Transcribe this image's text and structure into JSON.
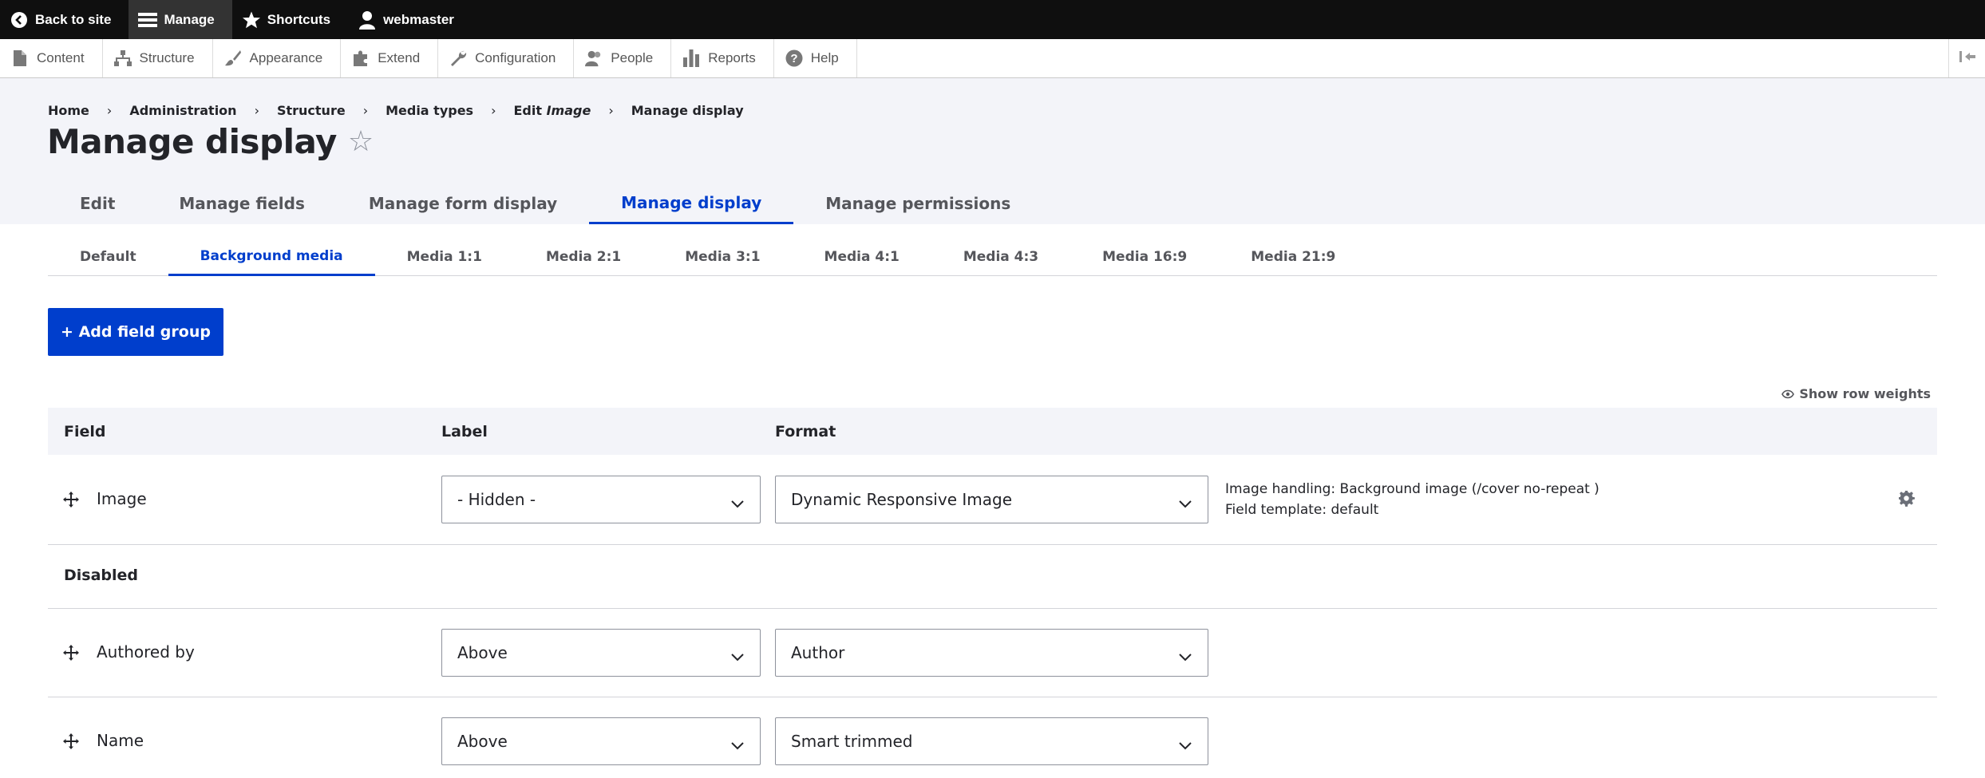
{
  "toolbar": {
    "back_to_site": "Back to site",
    "manage": "Manage",
    "shortcuts": "Shortcuts",
    "user": "webmaster"
  },
  "tray": {
    "items": [
      "Content",
      "Structure",
      "Appearance",
      "Extend",
      "Configuration",
      "People",
      "Reports",
      "Help"
    ]
  },
  "breadcrumb": {
    "items": [
      "Home",
      "Administration",
      "Structure",
      "Media types"
    ],
    "edit_prefix": "Edit ",
    "edit_em": "Image",
    "current": "Manage display",
    "separator": "›"
  },
  "page": {
    "title": "Manage display",
    "star": "☆"
  },
  "primary_tabs": [
    "Edit",
    "Manage fields",
    "Manage form display",
    "Manage display",
    "Manage permissions"
  ],
  "secondary_tabs": [
    "Default",
    "Background media",
    "Media 1:1",
    "Media 2:1",
    "Media 3:1",
    "Media 4:1",
    "Media 4:3",
    "Media 16:9",
    "Media 21:9"
  ],
  "add_field_group": "+ Add field group",
  "show_row_weights": "Show row weights",
  "table": {
    "headers": {
      "field": "Field",
      "label": "Label",
      "format": "Format"
    },
    "image_row": {
      "name": "Image",
      "label": "- Hidden -",
      "format": "Dynamic Responsive Image",
      "summary_line1": "Image handling: Background image (/cover no-repeat )",
      "summary_line2": "Field template: default"
    },
    "disabled_region": "Disabled",
    "authored_row": {
      "name": "Authored by",
      "label": "Above",
      "format": "Author"
    },
    "name_row": {
      "name": "Name",
      "label": "Above",
      "format": "Smart trimmed"
    }
  },
  "colors": {
    "accent": "#003ecc",
    "toolbar": "#0f0f0f",
    "header_bg": "#f3f4f9"
  }
}
